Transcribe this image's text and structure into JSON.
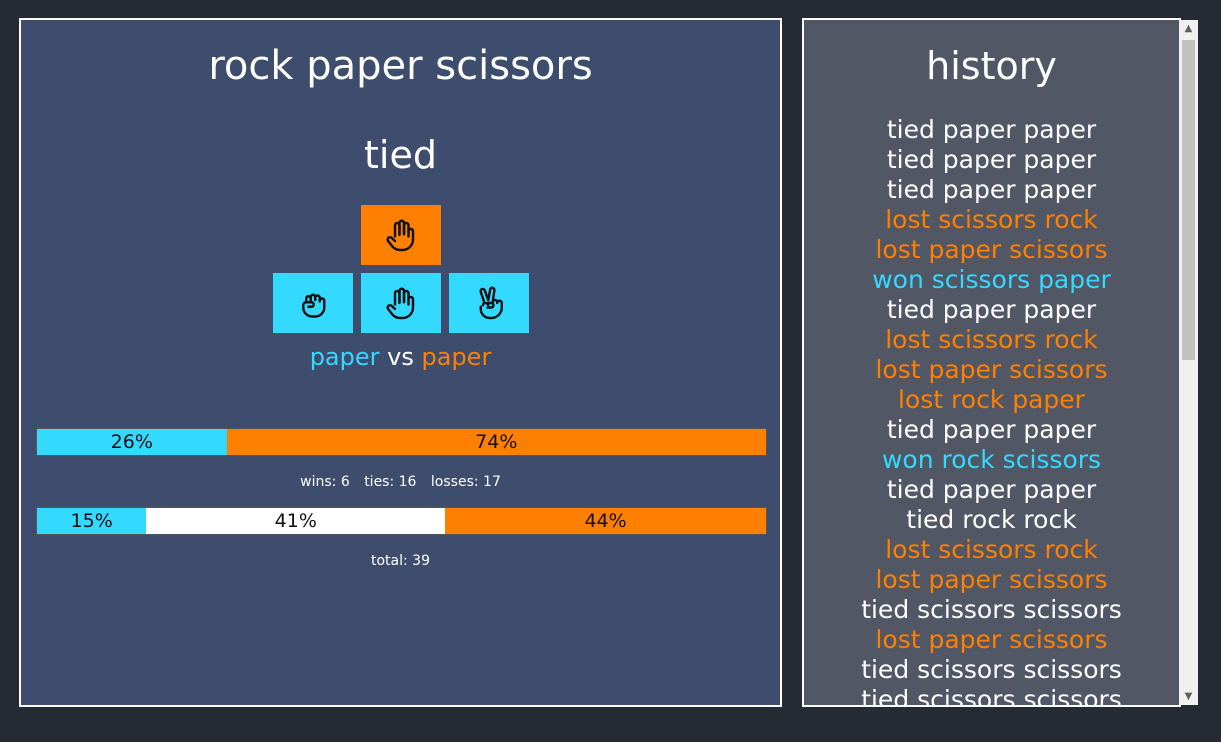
{
  "game": {
    "title": "rock paper scissors",
    "result": "tied",
    "cpu_choice": "paper",
    "buttons": [
      {
        "move": "rock",
        "icon": "fist-icon"
      },
      {
        "move": "paper",
        "icon": "open-hand-icon"
      },
      {
        "move": "scissors",
        "icon": "victory-hand-icon"
      }
    ],
    "matchup": {
      "player": "paper",
      "vs": "vs",
      "cpu": "paper"
    }
  },
  "win_loss_bar": {
    "win_percent": 26,
    "win_label": "26%",
    "loss_percent": 74,
    "loss_label": "74%"
  },
  "stats": {
    "wins": "wins: 6",
    "ties": "ties: 16",
    "losses": "losses: 17"
  },
  "outcome_bar": {
    "win_percent": 15,
    "win_label": "15%",
    "tie_percent": 41,
    "tie_label": "41%",
    "loss_percent": 44,
    "loss_label": "44%"
  },
  "total": "total: 39",
  "colors": {
    "player": "#33d9ff",
    "cpu": "#ff7f00",
    "tie": "#ffffff",
    "main_panel": "#3e4d6e",
    "history_panel": "#525766",
    "background": "#262a33"
  },
  "history": {
    "title": "history",
    "items": [
      {
        "text": "tied paper paper",
        "outcome": "tied"
      },
      {
        "text": "tied paper paper",
        "outcome": "tied"
      },
      {
        "text": "tied paper paper",
        "outcome": "tied"
      },
      {
        "text": "lost scissors rock",
        "outcome": "lost"
      },
      {
        "text": "lost paper scissors",
        "outcome": "lost"
      },
      {
        "text": "won scissors paper",
        "outcome": "won"
      },
      {
        "text": "tied paper paper",
        "outcome": "tied"
      },
      {
        "text": "lost scissors rock",
        "outcome": "lost"
      },
      {
        "text": "lost paper scissors",
        "outcome": "lost"
      },
      {
        "text": "lost rock paper",
        "outcome": "lost"
      },
      {
        "text": "tied paper paper",
        "outcome": "tied"
      },
      {
        "text": "won rock scissors",
        "outcome": "won"
      },
      {
        "text": "tied paper paper",
        "outcome": "tied"
      },
      {
        "text": "tied rock rock",
        "outcome": "tied"
      },
      {
        "text": "lost scissors rock",
        "outcome": "lost"
      },
      {
        "text": "lost paper scissors",
        "outcome": "lost"
      },
      {
        "text": "tied scissors scissors",
        "outcome": "tied"
      },
      {
        "text": "lost paper scissors",
        "outcome": "lost"
      },
      {
        "text": "tied scissors scissors",
        "outcome": "tied"
      },
      {
        "text": "tied scissors scissors",
        "outcome": "tied"
      }
    ]
  }
}
